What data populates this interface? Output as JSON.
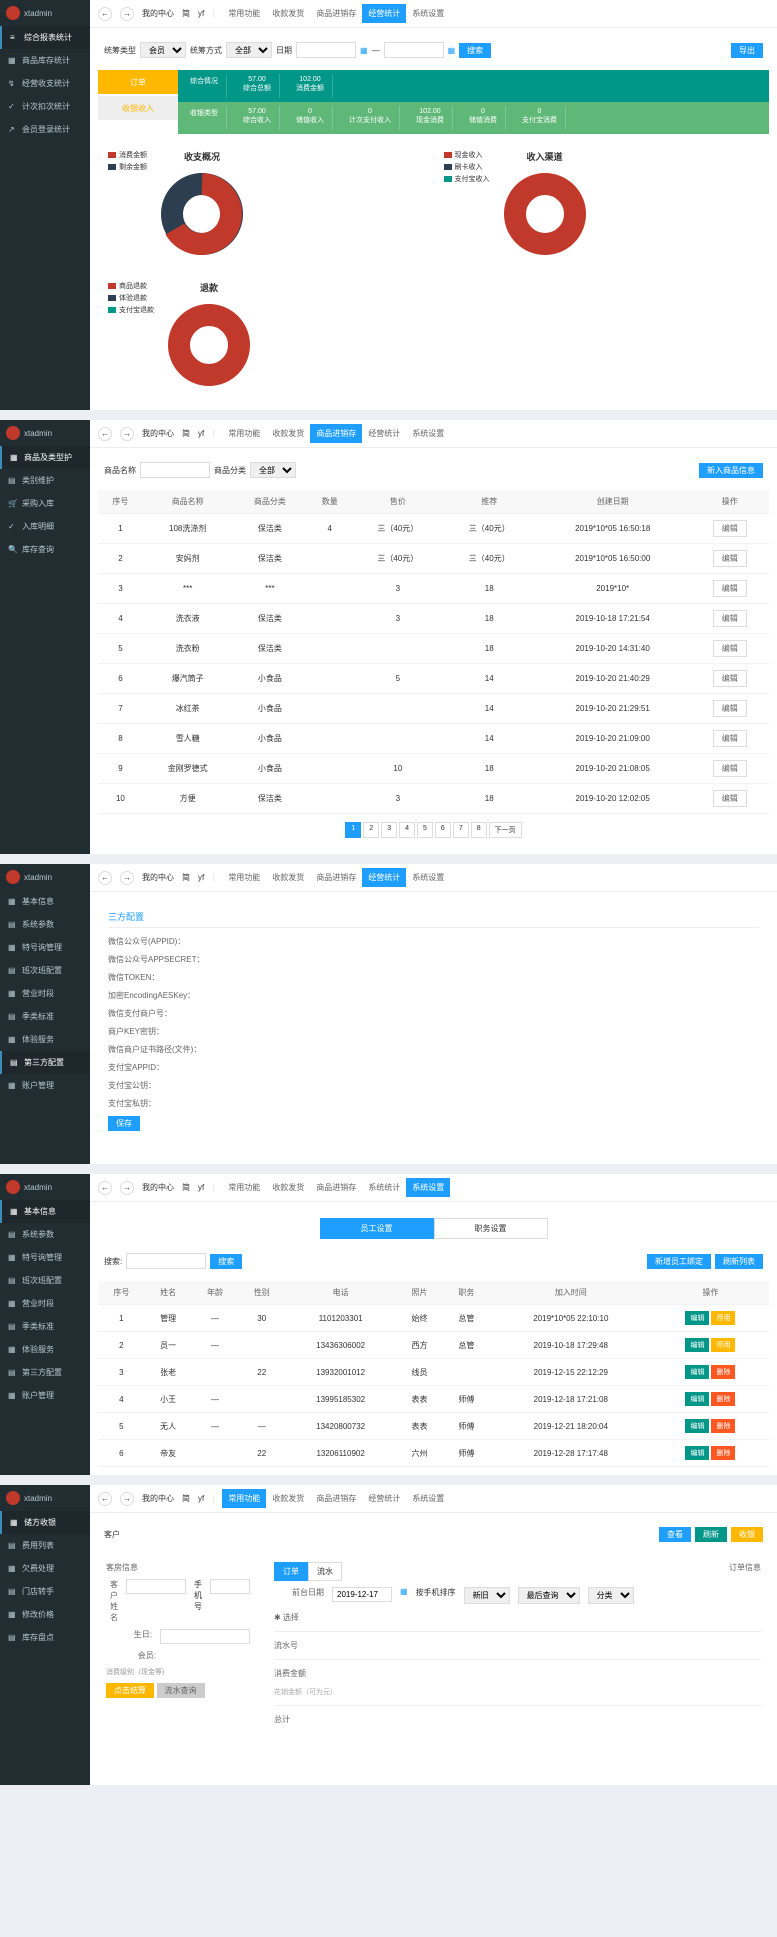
{
  "logo_text": "xtadmin",
  "topbar": {
    "user": "我的中心",
    "lang": "简",
    "yf": "yf"
  },
  "panel1": {
    "sidebar": [
      {
        "icon": "≡",
        "label": "综合报表统计",
        "active": true
      },
      {
        "icon": "▦",
        "label": "商品库存统计"
      },
      {
        "icon": "↯",
        "label": "经营收支统计"
      },
      {
        "icon": "✓",
        "label": "计次扣次统计"
      },
      {
        "icon": "↗",
        "label": "会员登录统计"
      }
    ],
    "nav": [
      "常用功能",
      "收款发货",
      "商品进销存",
      "经营统计",
      "系统设置"
    ],
    "nav_active": 3,
    "filters": {
      "f1": "统筹类型",
      "f1v": "会员",
      "f2": "统筹方式",
      "f2v": "全部",
      "f3": "日期",
      "btn_search": "搜索",
      "btn_export": "导出"
    },
    "stat_left": {
      "a": "订单",
      "b": "收银收入"
    },
    "stats_top": [
      {
        "t": "57.00",
        "b": "综合总额"
      },
      {
        "t": "102.00",
        "b": "消费金额"
      }
    ],
    "stats_bot": [
      {
        "t": "57.00",
        "b": "综合收入"
      },
      {
        "t": "0",
        "b": "储值收入"
      },
      {
        "t": "0",
        "b": "计次支付收入"
      },
      {
        "t": "102.00",
        "b": "现金消费"
      },
      {
        "t": "0",
        "b": "储值消费"
      },
      {
        "t": "0",
        "b": "支付宝消费"
      }
    ],
    "chart_data": [
      {
        "type": "pie",
        "title": "收支概况",
        "series": [
          {
            "name": "消费金额",
            "value": 102,
            "color": "#c0392b"
          },
          {
            "name": "剩余金额",
            "value": 57,
            "color": "#2c3e50"
          }
        ]
      },
      {
        "type": "pie",
        "title": "收入渠道",
        "series": [
          {
            "name": "现金收入",
            "value": 100,
            "color": "#c0392b"
          },
          {
            "name": "刷卡收入",
            "value": 0,
            "color": "#2c3e50"
          },
          {
            "name": "支付宝收入",
            "value": 0,
            "color": "#009688"
          }
        ]
      },
      {
        "type": "pie",
        "title": "退款",
        "series": [
          {
            "name": "商品退款",
            "value": 100,
            "color": "#c0392b"
          },
          {
            "name": "体验退款",
            "value": 0,
            "color": "#2c3e50"
          },
          {
            "name": "支付宝退款",
            "value": 0,
            "color": "#009688"
          }
        ]
      }
    ]
  },
  "panel2": {
    "sidebar": [
      {
        "icon": "▦",
        "label": "商品及类型护",
        "active": true
      },
      {
        "icon": "▤",
        "label": "类别维护"
      },
      {
        "icon": "🛒",
        "label": "采购入库"
      },
      {
        "icon": "✓",
        "label": "入库明细"
      },
      {
        "icon": "🔍",
        "label": "库存查询"
      }
    ],
    "nav": [
      "常用功能",
      "收款发货",
      "商品进销存",
      "经营统计",
      "系统设置"
    ],
    "nav_active": 2,
    "header": {
      "f1": "商品名称",
      "f2": "商品分类",
      "f2v": "全部",
      "btn_add": "新入商品信息"
    },
    "columns": [
      "序号",
      "商品名称",
      "商品分类",
      "数量",
      "售价",
      "推荐",
      "创建日期",
      "操作"
    ],
    "rows": [
      [
        "1",
        "108洗涤剂",
        "保洁类",
        "4",
        "三（40元）",
        "三（40元）",
        "2019*10*05 16:50:18",
        "编辑"
      ],
      [
        "2",
        "安妈剂",
        "保洁类",
        "",
        "三（40元）",
        "三（40元）",
        "2019*10*05 16:50:00",
        "编辑"
      ],
      [
        "3",
        "***",
        "***",
        "",
        "3",
        "18",
        "2019*10*",
        "编辑"
      ],
      [
        "4",
        "洗衣液",
        "保洁类",
        "",
        "3",
        "18",
        "2019-10-18 17:21:54",
        "编辑"
      ],
      [
        "5",
        "洗衣粉",
        "保洁类",
        "",
        "",
        "18",
        "2019-10-20 14:31:40",
        "编辑"
      ],
      [
        "6",
        "爆汽筒子",
        "小食品",
        "",
        "5",
        "14",
        "2019-10-20 21:40:29",
        "编辑"
      ],
      [
        "7",
        "冰红茶",
        "小食品",
        "",
        "",
        "14",
        "2019-10-20 21:29:51",
        "编辑"
      ],
      [
        "8",
        "雪人糖",
        "小食品",
        "",
        "",
        "14",
        "2019-10-20 21:09:00",
        "编辑"
      ],
      [
        "9",
        "金刚罗德式",
        "小食品",
        "",
        "10",
        "18",
        "2019-10-20 21:08:05",
        "编辑"
      ],
      [
        "10",
        "方便",
        "保洁类",
        "",
        "3",
        "18",
        "2019-10-20 12:02:05",
        "编辑"
      ]
    ],
    "pager": [
      "1",
      "2",
      "3",
      "4",
      "5",
      "6",
      "7",
      "8",
      "下一页"
    ]
  },
  "panel3": {
    "sidebar": [
      {
        "icon": "▦",
        "label": "基本信息"
      },
      {
        "icon": "▤",
        "label": "系统参数"
      },
      {
        "icon": "▦",
        "label": "特号询管理"
      },
      {
        "icon": "▤",
        "label": "班次班配置"
      },
      {
        "icon": "▦",
        "label": "营业时段"
      },
      {
        "icon": "▤",
        "label": "季类标准"
      },
      {
        "icon": "▦",
        "label": "体验服务"
      },
      {
        "icon": "▤",
        "label": "第三方配置",
        "active": true
      },
      {
        "icon": "▦",
        "label": "账户管理"
      }
    ],
    "nav": [
      "常用功能",
      "收款发货",
      "商品进销存",
      "经营统计",
      "系统设置"
    ],
    "nav_active": 3,
    "title": "三方配置",
    "fields": [
      "微信公众号(APPID)",
      "微信公众号APPSECRET",
      "微信TOKEN",
      "加密EncodingAESKey",
      "微信支付商户号",
      "商户KEY密钥",
      "微信商户证书路径(文件)",
      "支付宝APPID",
      "支付宝公钥",
      "支付宝私钥"
    ],
    "btn": "保存"
  },
  "panel4": {
    "sidebar": [
      {
        "icon": "▦",
        "label": "基本信息",
        "active": true
      },
      {
        "icon": "▤",
        "label": "系统参数"
      },
      {
        "icon": "▦",
        "label": "特号询管理"
      },
      {
        "icon": "▤",
        "label": "班次班配置"
      },
      {
        "icon": "▦",
        "label": "营业时段"
      },
      {
        "icon": "▤",
        "label": "季类标准"
      },
      {
        "icon": "▦",
        "label": "体验服务"
      },
      {
        "icon": "▤",
        "label": "第三方配置"
      },
      {
        "icon": "▦",
        "label": "账户管理"
      }
    ],
    "nav": [
      "常用功能",
      "收款发货",
      "商品进销存",
      "系统统计",
      "系统设置"
    ],
    "nav_active": 4,
    "tabs": [
      "员工设置",
      "职务设置"
    ],
    "search_label": "搜索:",
    "btn_search": "搜索",
    "btn_add": "新增员工绑定",
    "btn_ref": "刷新列表",
    "columns": [
      "序号",
      "姓名",
      "年龄",
      "性别",
      "电话",
      "照片",
      "职务",
      "加入时间",
      "操作"
    ],
    "rows": [
      [
        "1",
        "管理",
        "—",
        "30",
        "1101203301",
        "始终",
        "总管",
        "2019*10*05 22:10:10"
      ],
      [
        "2",
        "员一",
        "—",
        "",
        "13436306002",
        "西方",
        "总管",
        "2019-10-18 17:29:48"
      ],
      [
        "3",
        "张老",
        "",
        "22",
        "13932001012",
        "线员",
        "",
        "2019-12-15 22:12:29"
      ],
      [
        "4",
        "小王",
        "—",
        "",
        "13995185302",
        "表表",
        "师傅",
        "2019-12-18 17:21:08"
      ],
      [
        "5",
        "无人",
        "—",
        "—",
        "13420800732",
        "表表",
        "师傅",
        "2019-12-21 18:20:04"
      ],
      [
        "6",
        "帝友",
        "",
        "22",
        "13206110902",
        "六州",
        "师傅",
        "2019-12-28 17:17:48"
      ]
    ],
    "ops": {
      "g": "编辑",
      "o": "停用",
      "r": "删除"
    }
  },
  "panel5": {
    "sidebar": [
      {
        "icon": "▦",
        "label": "储方收银",
        "active": true
      },
      {
        "icon": "▤",
        "label": "费用列表"
      },
      {
        "icon": "▦",
        "label": "欠费处理"
      },
      {
        "icon": "▤",
        "label": "门店转手"
      },
      {
        "icon": "▦",
        "label": "修改价格"
      },
      {
        "icon": "▤",
        "label": "库存盘点"
      }
    ],
    "nav": [
      "常用功能",
      "收款发货",
      "商品进销存",
      "经营统计",
      "系统设置"
    ],
    "nav_active": 0,
    "top_btns": [
      "查看",
      "刷新",
      "收银"
    ],
    "title": "客户",
    "left": {
      "t": "客房信息",
      "f1": "客户姓名",
      "f2": "手机号",
      "f3": "生日:",
      "f4": "会员:",
      "f5": "消费级别（现金等)"
    },
    "right": {
      "tabs": [
        "订单",
        "流水"
      ],
      "fr": "订单信息",
      "date_l": "前台日期",
      "date_v": "2019-12-17",
      "sel1": "按手机排序",
      "sel1v": "新旧",
      "sel2": "最后查询",
      "sel3": "分类",
      "sec1": "✱ 选择",
      "sec2": "流水号",
      "sec3": "消费金额",
      "note": "花销金额（可为元）",
      "sec4": "总计"
    },
    "bot_btns": [
      "点击结算",
      "流水查询"
    ]
  }
}
